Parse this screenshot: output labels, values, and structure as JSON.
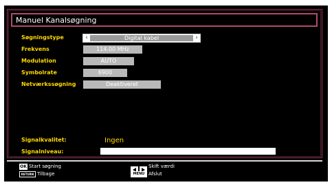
{
  "title": "Manuel Kanalsøgning",
  "fields": [
    {
      "label": "Søgningstype",
      "value": "Digital kabel"
    },
    {
      "label": "Frekvens",
      "value": "114.00 MHz"
    },
    {
      "label": "Modulation",
      "value": "AUTO"
    },
    {
      "label": "Symbolrate",
      "value": "6900"
    },
    {
      "label": "Netværkssøgning",
      "value": "Deaktiveret"
    }
  ],
  "signal": {
    "quality_label": "Signalkvalitet:",
    "quality_value": "Ingen",
    "level_label": "Signalniveau:",
    "level_fraction": 1.0
  },
  "help": {
    "ok_key": "OK",
    "ok_text": "Start søgning",
    "return_key": "RETURN",
    "return_text": "Tilbage",
    "lr_text": "Skift værdi",
    "menu_key": "MENU",
    "menu_text": "Afslut"
  }
}
